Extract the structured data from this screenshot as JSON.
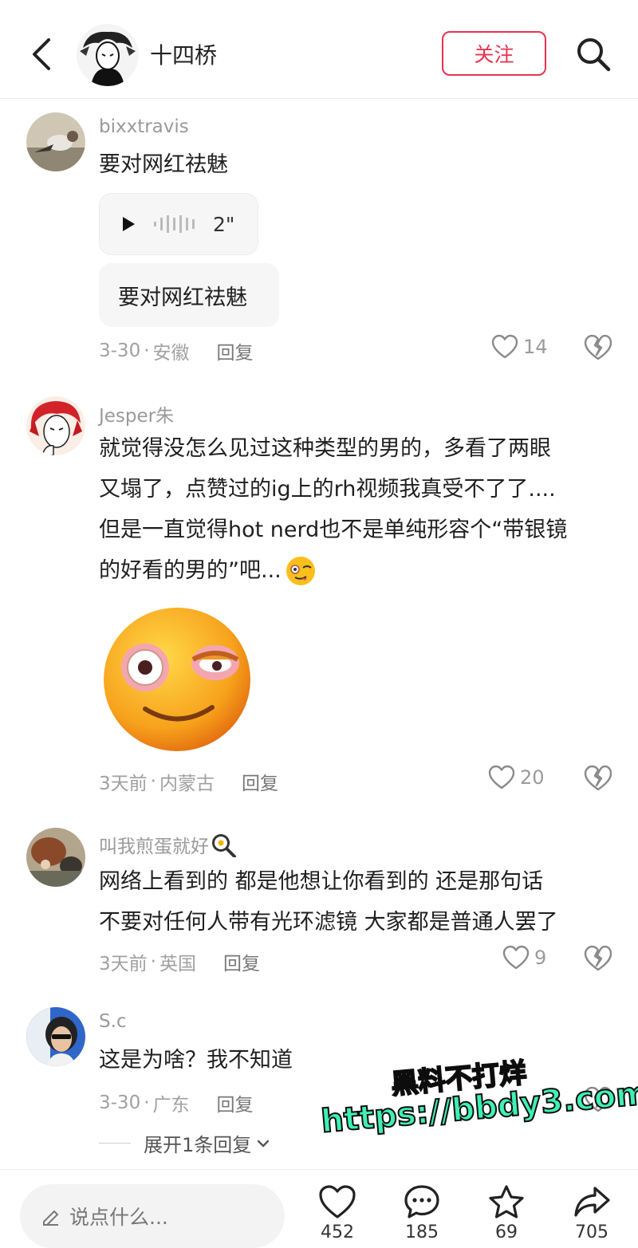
{
  "header": {
    "title": "十四桥",
    "follow_label": "关注",
    "icons": {
      "back": "back-chevron-icon",
      "search": "search-icon"
    }
  },
  "comments": [
    {
      "username": "bixxtravis",
      "text_lines": [
        "要对网红祛魅"
      ],
      "voice_duration": "2\"",
      "transcript": "要对网红祛魅",
      "date": "3-30",
      "location": "安徽",
      "reply_label": "回复",
      "likes": "14"
    },
    {
      "username": "Jesper朱",
      "text_lines": [
        "就觉得没怎么见过这种类型的男的，多看了两眼",
        "又塌了，点赞过的ig上的rh视频我真受不了了....",
        "但是一直觉得hot nerd也不是单纯形容个“带银镜",
        "的好看的男的”吧..."
      ],
      "sticker": "flushed-wink-emoji-sticker",
      "date": "3天前",
      "location": "内蒙古",
      "reply_label": "回复",
      "likes": "20"
    },
    {
      "username": "叫我煎蛋就好",
      "text_lines": [
        "网络上看到的 都是他想让你看到的 还是那句话",
        "不要对任何人带有光环滤镜 大家都是普通人罢了"
      ],
      "date": "3天前",
      "location": "英国",
      "reply_label": "回复",
      "likes": "9"
    },
    {
      "username": "S.c",
      "text_lines": [
        "这是为啥？我不知道"
      ],
      "date": "3-30",
      "location": "广东",
      "reply_label": "回复",
      "expand_label": "展开1条回复"
    }
  ],
  "watermark": {
    "line1": "黑料不打烊",
    "line2": "https://bbdy3.com"
  },
  "bottom_bar": {
    "input_placeholder": "说点什么...",
    "likes": "452",
    "comments": "185",
    "favorites": "69",
    "shares": "705"
  },
  "colors": {
    "accent": "#e6334f",
    "watermark": "#3ff0b4"
  }
}
